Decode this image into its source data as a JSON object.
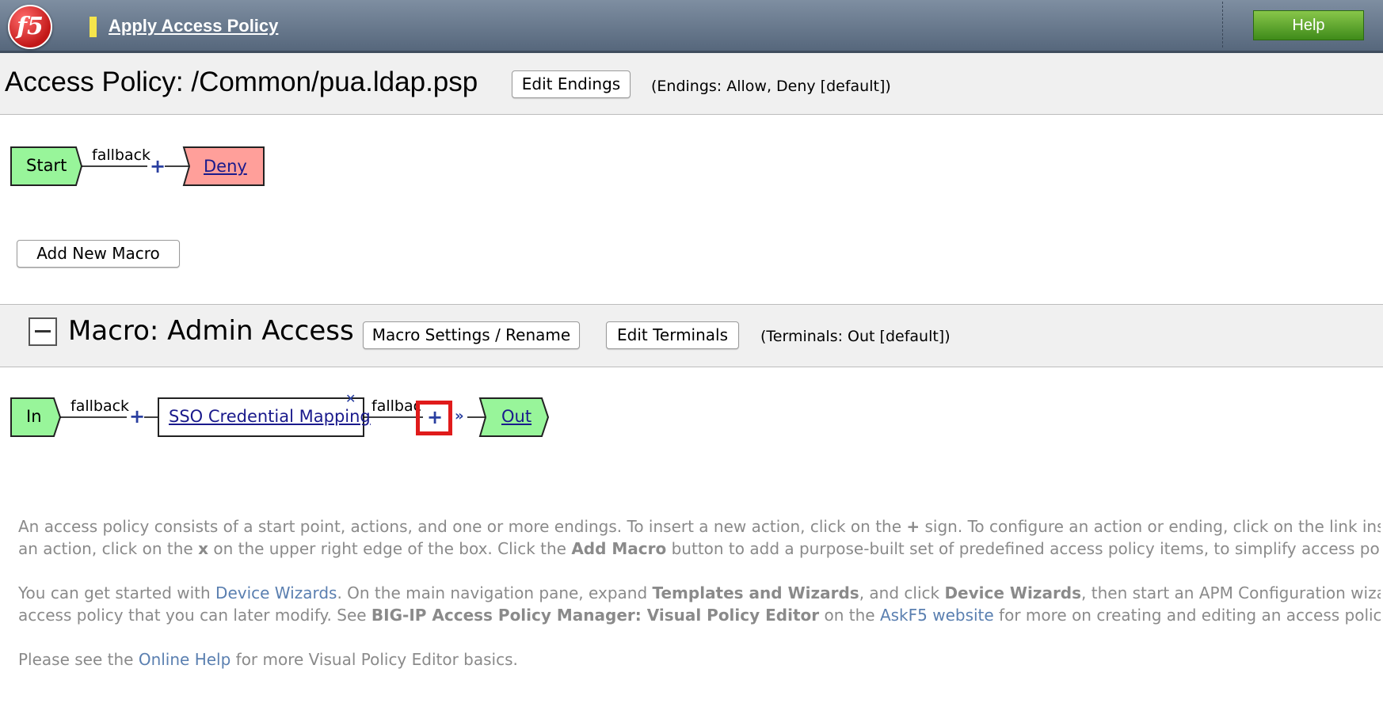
{
  "header": {
    "logo_text": "f5",
    "title": "Apply Access Policy",
    "help_label": "Help"
  },
  "policy": {
    "title": "Access Policy: /Common/pua.ldap.psp",
    "edit_endings_label": "Edit Endings",
    "endings_text": "(Endings: Allow, Deny [default])",
    "flow": {
      "start": "Start",
      "edge": "fallback",
      "ending": "Deny"
    },
    "add_macro_label": "Add New Macro"
  },
  "macro": {
    "title": "Macro: Admin Access",
    "settings_label": "Macro Settings / Rename",
    "edit_terminals_label": "Edit Terminals",
    "terminals_text": "(Terminals: Out [default])",
    "flow": {
      "in": "In",
      "edge1": "fallback",
      "action": "SSO Credential Mapping",
      "edge2": "fallbac",
      "out": "Out"
    }
  },
  "info": {
    "p1": {
      "t1": "An access policy consists of a start point, actions, and one or more endings. To insert a new action, click on the ",
      "b1": "+",
      "t2": " sign. To configure an action or ending, click on the link inside t",
      "t3": "an action, click on the ",
      "b2": "x",
      "t4": " on the upper right edge of the box. Click the ",
      "b3": "Add Macro",
      "t5": " button to add a purpose-built set of predefined access policy items, to simplify access policy cr"
    },
    "p2": {
      "t1": "You can get started with ",
      "link1": "Device Wizards",
      "t2": ". On the main navigation pane, expand ",
      "b1": "Templates and Wizards",
      "t3": ", and click ",
      "b2": "Device Wizards",
      "t4": ", then start an APM Configuration wizard, t",
      "t5": "access policy that you can later modify. See ",
      "b3": "BIG-IP Access Policy Manager: Visual Policy Editor",
      "t6": " on the ",
      "link2": "AskF5 website",
      "t7": " for more on creating and editing an access policy."
    },
    "p3": {
      "t1": "Please see the ",
      "link": "Online Help",
      "t2": " for more Visual Policy Editor basics."
    }
  },
  "colors": {
    "start_green": "#98f59a",
    "deny_red": "#ff9f9a",
    "highlight": "#e01b1b",
    "help_green": "#5aa52a"
  }
}
